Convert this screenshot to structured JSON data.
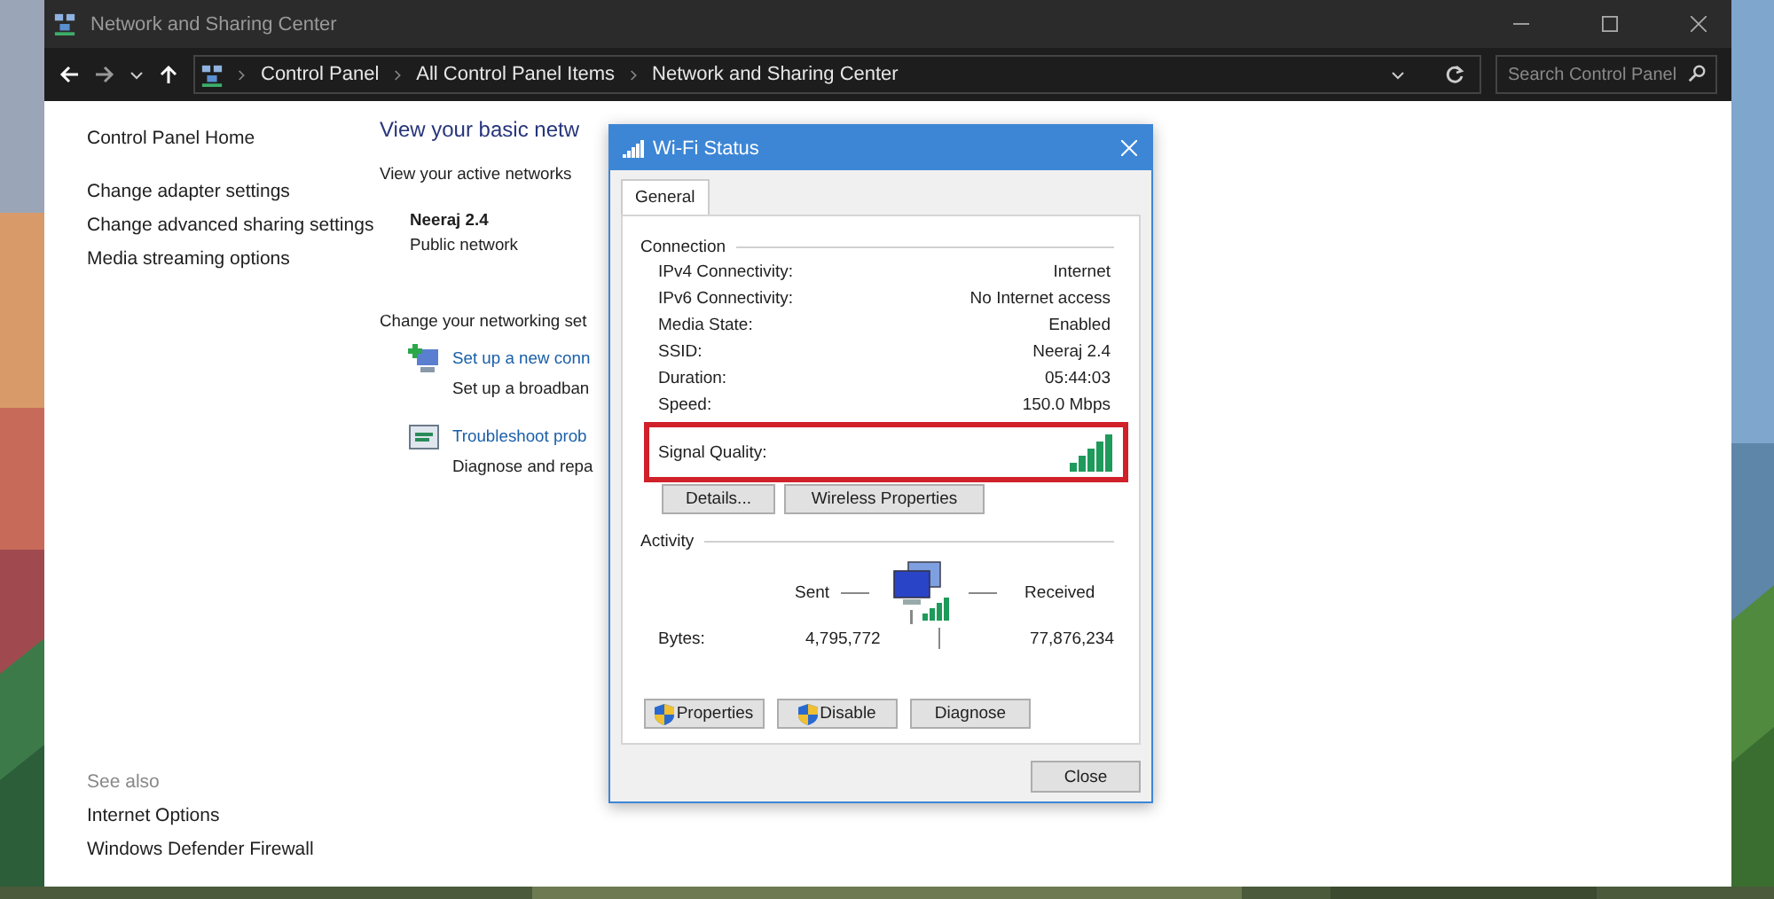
{
  "window": {
    "title": "Network and Sharing Center"
  },
  "address_bar": {
    "breadcrumbs": [
      "Control Panel",
      "All Control Panel Items",
      "Network and Sharing Center"
    ]
  },
  "search": {
    "placeholder": "Search Control Panel"
  },
  "sidebar": {
    "items": [
      "Control Panel Home",
      "Change adapter settings",
      "Change advanced sharing settings",
      "Media streaming options"
    ],
    "see_also": {
      "title": "See also",
      "items": [
        "Internet Options",
        "Windows Defender Firewall"
      ]
    }
  },
  "main": {
    "heading": "View your basic netw",
    "active_networks_label": "View your active networks",
    "network": {
      "name": "Neeraj 2.4",
      "type": "Public network"
    },
    "change_label": "Change your networking set",
    "tasks": [
      {
        "link": "Set up a new conn",
        "description": "Set up a broadban"
      },
      {
        "link": "Troubleshoot prob",
        "description": "Diagnose and repa"
      }
    ]
  },
  "dialog": {
    "title": "Wi-Fi Status",
    "tabs": [
      {
        "label": "General",
        "selected": true
      }
    ],
    "connection": {
      "title": "Connection",
      "rows": [
        {
          "kind": "text",
          "label": "IPv4 Connectivity:",
          "value": "Internet",
          "highlighted": false
        },
        {
          "kind": "text",
          "label": "IPv6 Connectivity:",
          "value": "No Internet access",
          "highlighted": false
        },
        {
          "kind": "text",
          "label": "Media State:",
          "value": "Enabled",
          "highlighted": false
        },
        {
          "kind": "text",
          "label": "SSID:",
          "value": "Neeraj 2.4",
          "highlighted": false
        },
        {
          "kind": "text",
          "label": "Duration:",
          "value": "05:44:03",
          "highlighted": false
        },
        {
          "kind": "text",
          "label": "Speed:",
          "value": "150.0 Mbps",
          "highlighted": false
        },
        {
          "kind": "signal",
          "label": "Signal Quality:",
          "highlighted": true
        }
      ]
    },
    "connection_buttons": [
      "Details...",
      "Wireless Properties"
    ],
    "activity": {
      "title": "Activity",
      "sent_label": "Sent",
      "received_label": "Received",
      "bytes_label": "Bytes:",
      "sent": "4,795,772",
      "received": "77,876,234"
    },
    "action_buttons": [
      {
        "label": "Properties",
        "shield": true
      },
      {
        "label": "Disable",
        "shield": true
      },
      {
        "label": "Diagnose",
        "shield": false
      }
    ],
    "close_button": "Close"
  }
}
